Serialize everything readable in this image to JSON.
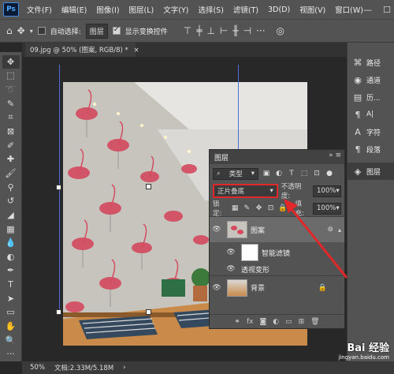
{
  "app": {
    "logo": "Ps"
  },
  "menu": [
    "文件(F)",
    "编辑(E)",
    "图像(I)",
    "图层(L)",
    "文字(Y)",
    "选择(S)",
    "滤镜(T)",
    "3D(D)",
    "视图(V)",
    "窗口(W)"
  ],
  "window_controls": {
    "minimize": "—",
    "maximize": "☐"
  },
  "options": {
    "auto_select_label": "自动选择:",
    "auto_select_value": "图层",
    "show_transform_label": "显示变换控件",
    "more": "···"
  },
  "document": {
    "tab_title": "09.jpg @ 50% (图案, RGB/8) *",
    "close": "×"
  },
  "side_panels": [
    {
      "icon": "paths-icon",
      "label": "路径"
    },
    {
      "icon": "channels-icon",
      "label": "通道"
    },
    {
      "icon": "history-icon",
      "label": "历..."
    },
    {
      "icon": "paragraph-icon",
      "label": "A|"
    },
    {
      "icon": "character-icon",
      "label": "字符"
    },
    {
      "icon": "paragraph-mark-icon",
      "label": "段落"
    },
    {
      "icon": "layers-icon",
      "label": "图层"
    }
  ],
  "layers_panel": {
    "title": "图层",
    "filter_kind": "类型",
    "blend_mode": "正片叠底",
    "opacity_label": "不透明度:",
    "opacity_value": "100%",
    "lock_label": "锁定:",
    "fill_label": "填充:",
    "fill_value": "100%",
    "layers": [
      {
        "name": "图案",
        "type": "smart-object",
        "selected": true
      },
      {
        "name": "智能滤镜",
        "type": "filter-mask"
      },
      {
        "name": "透视变形",
        "type": "filter"
      },
      {
        "name": "背景",
        "type": "background",
        "locked": true
      }
    ]
  },
  "status": {
    "zoom": "50%",
    "doc_info": "文档:2.33M/5.18M"
  },
  "watermark": {
    "brand": "Bai 经验",
    "url": "jingyan.baidu.com"
  },
  "colors": {
    "accent_red": "#e0282a",
    "panel_bg": "#535353"
  }
}
